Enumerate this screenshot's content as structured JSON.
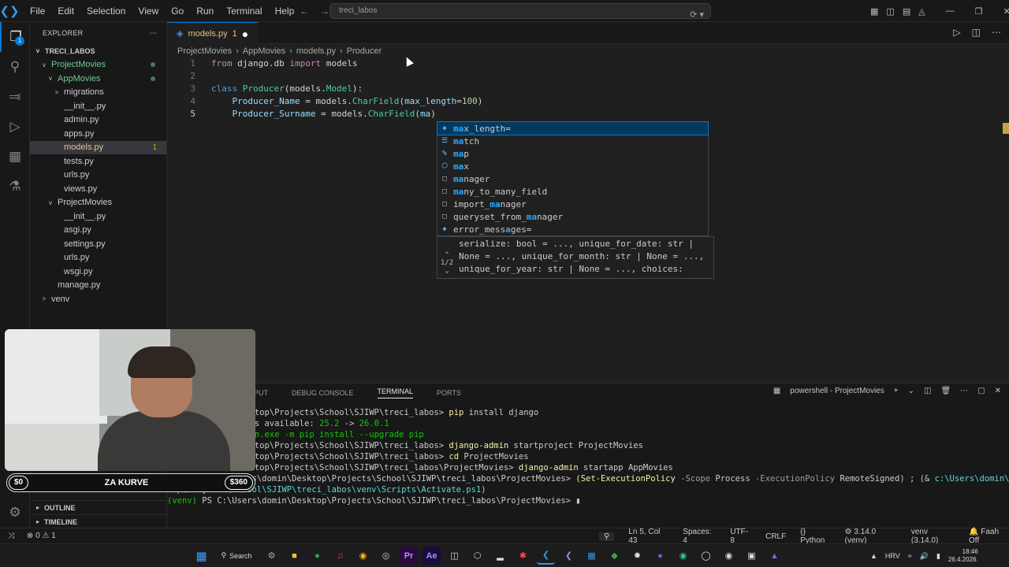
{
  "titlebar": {
    "menu": [
      "File",
      "Edit",
      "Selection",
      "View",
      "Go",
      "Run",
      "Terminal",
      "Help"
    ],
    "search": "treci_labos"
  },
  "activity": {
    "explorer_badge": "1"
  },
  "explorer": {
    "header": "EXPLORER",
    "root": "TRECI_LABOS",
    "tree": [
      {
        "label": "ProjectMovies",
        "indent": 1,
        "chev": "v",
        "cls": "green",
        "dot": true
      },
      {
        "label": "AppMovies",
        "indent": 2,
        "chev": "v",
        "cls": "green",
        "dot": true
      },
      {
        "label": "migrations",
        "indent": 3,
        "chev": ">",
        "cls": ""
      },
      {
        "label": "__init__.py",
        "indent": 3,
        "chev": "",
        "cls": ""
      },
      {
        "label": "admin.py",
        "indent": 3,
        "chev": "",
        "cls": ""
      },
      {
        "label": "apps.py",
        "indent": 3,
        "chev": "",
        "cls": ""
      },
      {
        "label": "models.py",
        "indent": 3,
        "chev": "",
        "cls": "yellow",
        "count": "1",
        "selected": true
      },
      {
        "label": "tests.py",
        "indent": 3,
        "chev": "",
        "cls": ""
      },
      {
        "label": "urls.py",
        "indent": 3,
        "chev": "",
        "cls": ""
      },
      {
        "label": "views.py",
        "indent": 3,
        "chev": "",
        "cls": ""
      },
      {
        "label": "ProjectMovies",
        "indent": 2,
        "chev": "v",
        "cls": ""
      },
      {
        "label": "__init__.py",
        "indent": 3,
        "chev": "",
        "cls": ""
      },
      {
        "label": "asgi.py",
        "indent": 3,
        "chev": "",
        "cls": ""
      },
      {
        "label": "settings.py",
        "indent": 3,
        "chev": "",
        "cls": ""
      },
      {
        "label": "urls.py",
        "indent": 3,
        "chev": "",
        "cls": ""
      },
      {
        "label": "wsgi.py",
        "indent": 3,
        "chev": "",
        "cls": ""
      },
      {
        "label": "manage.py",
        "indent": 2,
        "chev": "",
        "cls": ""
      },
      {
        "label": "venv",
        "indent": 1,
        "chev": ">",
        "cls": ""
      }
    ],
    "outline": "OUTLINE",
    "timeline": "TIMELINE"
  },
  "editor": {
    "tab_label": "models.py",
    "tab_count": "1",
    "breadcrumbs": [
      "ProjectMovies",
      "AppMovies",
      "models.py",
      "Producer"
    ]
  },
  "suggest": [
    {
      "pre": "",
      "hi": "ma",
      "post": "x_length=",
      "icon": "field"
    },
    {
      "pre": "",
      "hi": "ma",
      "post": "tch",
      "icon": "kw"
    },
    {
      "pre": "",
      "hi": "ma",
      "post": "p",
      "icon": "class"
    },
    {
      "pre": "",
      "hi": "ma",
      "post": "x",
      "icon": "func"
    },
    {
      "pre": "",
      "hi": "ma",
      "post": "nager",
      "icon": "box"
    },
    {
      "pre": "",
      "hi": "ma",
      "post": "ny_to_many_field",
      "icon": "box"
    },
    {
      "pre": "import_",
      "hi": "ma",
      "post": "nager",
      "icon": "box"
    },
    {
      "pre": "queryset_from_",
      "hi": "ma",
      "post": "nager",
      "icon": "box"
    },
    {
      "pre": "error_mess",
      "hi": "a",
      "post": "ges=",
      "icon": "field"
    }
  ],
  "signature": {
    "counter": "1/2",
    "lines": [
      "serialize: bool = ..., unique_for_date: str |",
      "None = ..., unique_for_month: str | None = ...,",
      "unique_for_year: str | None = ..., choices:"
    ]
  },
  "panel": {
    "tabs": [
      "PUT",
      "DEBUG CONSOLE",
      "TERMINAL",
      "PORTS"
    ],
    "shell": "powershell - ProjectMovies"
  },
  "webcam": {
    "left": "$0",
    "center": "ZA KURVE",
    "right": "$360"
  },
  "statusbar": {
    "errors": "0",
    "warnings": "1",
    "position": "Ln 5, Col 43",
    "spaces": "Spaces: 4",
    "encoding": "UTF-8",
    "eol": "CRLF",
    "language": "Python",
    "interpreter": "3.14.0 (venv)",
    "venv": "venv (3.14.0)",
    "fash": "Faah Off"
  },
  "taskbar": {
    "search": "Search",
    "lang": "HRV",
    "time": "18:46",
    "date": "26.4.2026."
  }
}
